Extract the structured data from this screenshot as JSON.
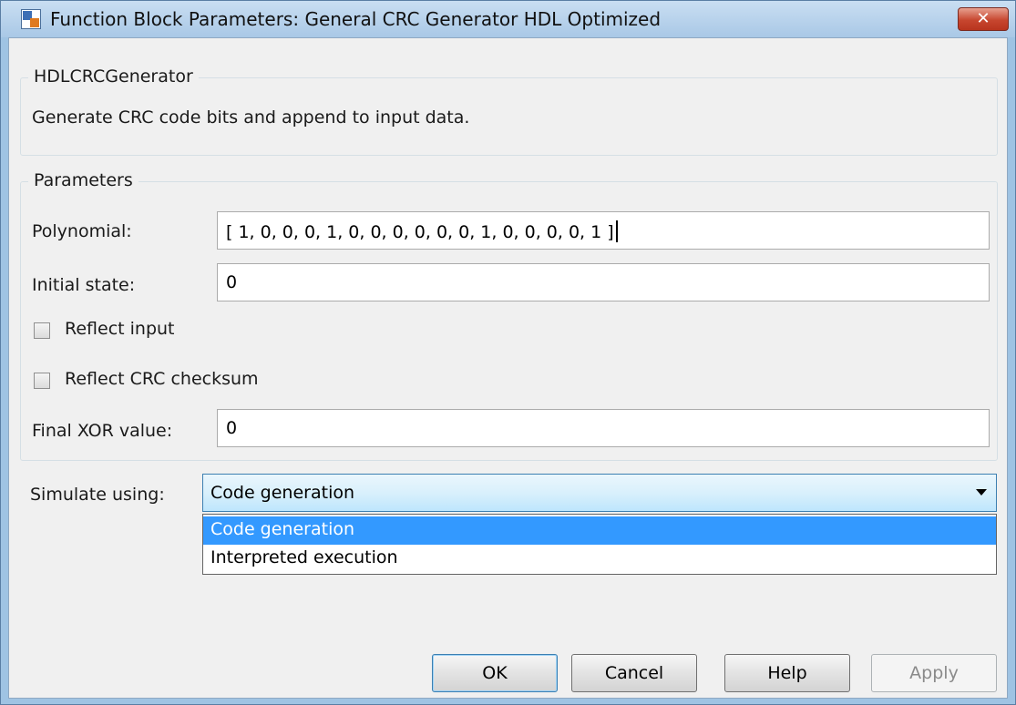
{
  "window": {
    "title": "Function Block Parameters: General CRC Generator HDL Optimized",
    "close_label": "✕"
  },
  "block": {
    "name": "HDLCRCGenerator",
    "description": "Generate CRC code bits and append to input data."
  },
  "parameters": {
    "group_label": "Parameters",
    "polynomial": {
      "label": "Polynomial:",
      "value": "[ 1, 0, 0, 0, 1, 0, 0, 0, 0, 0, 0, 1, 0, 0, 0, 0, 1 ]"
    },
    "initial_state": {
      "label": "Initial state:",
      "value": "0"
    },
    "reflect_input": {
      "label": "Reflect input",
      "checked": false
    },
    "reflect_crc_checksum": {
      "label": "Reflect CRC checksum",
      "checked": false
    },
    "final_xor_value": {
      "label": "Final XOR value:",
      "value": "0"
    }
  },
  "simulate_using": {
    "label": "Simulate using:",
    "selected": "Code generation",
    "options": [
      "Code generation",
      "Interpreted execution"
    ]
  },
  "buttons": {
    "ok": "OK",
    "cancel": "Cancel",
    "help": "Help",
    "apply": "Apply"
  },
  "icons": {
    "app": "simulink-block-icon",
    "close": "close-icon",
    "dropdown": "chevron-down-icon"
  },
  "colors": {
    "title_bar": "#a9c8e6",
    "close_button": "#c7462f",
    "selection": "#3399ff",
    "client_background": "#f0f0f0"
  }
}
